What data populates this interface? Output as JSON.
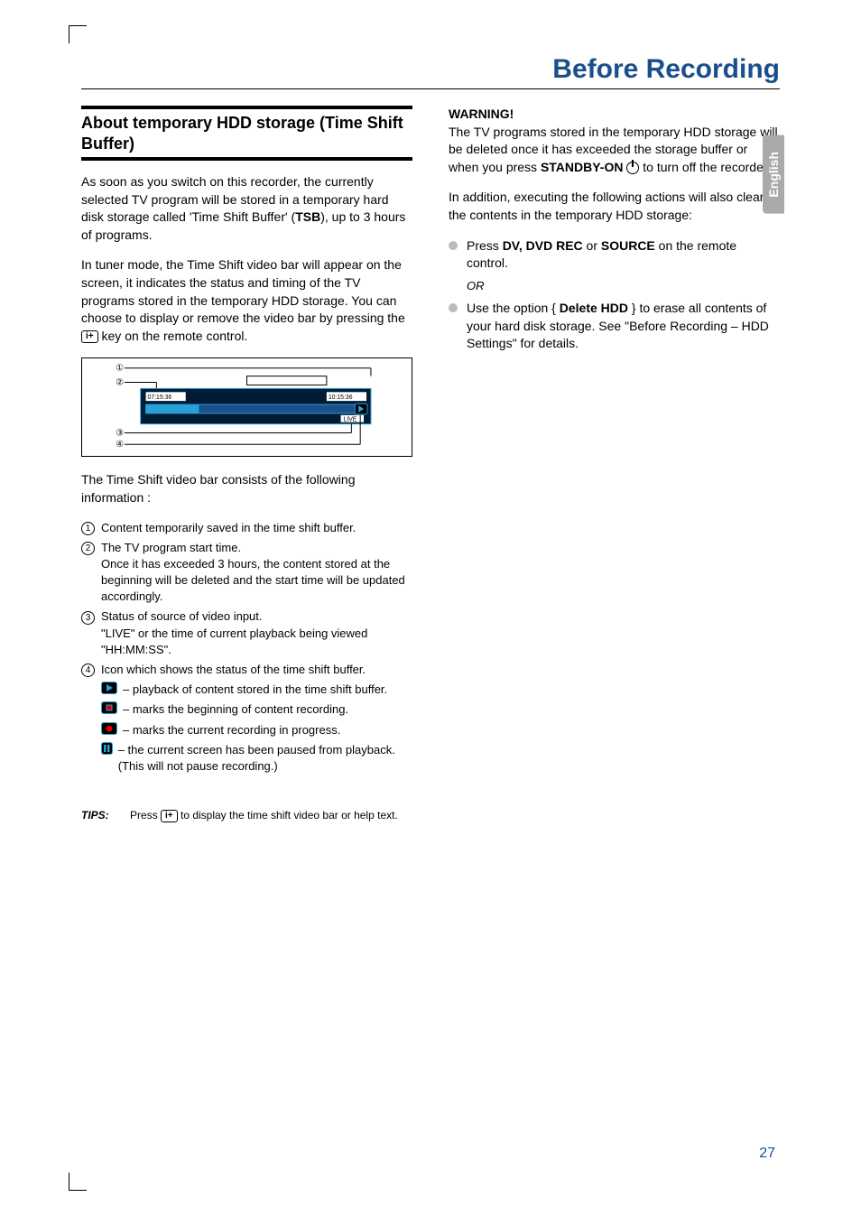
{
  "page": {
    "language_tab": "English",
    "page_number": "27",
    "header_title": "Before Recording"
  },
  "left": {
    "section_title": "About temporary HDD storage (Time Shift Buffer)",
    "para1_a": "As soon as you switch on this recorder, the currently selected TV program will be stored in a temporary hard disk storage called 'Time Shift Buffer' (",
    "para1_b": "TSB",
    "para1_c": "), up to 3 hours of programs.",
    "para2_a": "In tuner mode, the Time Shift video bar will appear on the screen, it indicates the status and timing of the TV programs stored in the temporary HDD storage. You can choose to display or remove the video bar by pressing the ",
    "para2_b": " key on the remote control.",
    "videobar": {
      "start_time": "07:15:36",
      "end_time": "10:15:36",
      "status": "LIVE"
    },
    "para3": "The Time Shift video bar consists of the following information :",
    "legend": {
      "n1": "Content temporarily saved in the time shift buffer.",
      "n2": "The TV program start time.\nOnce it has exceeded 3 hours, the content stored at the beginning will be deleted and the start time will be updated accordingly.",
      "n3": "Status of source of video input.\n\"LIVE\" or the time of current playback being viewed \"HH:MM:SS\".",
      "n4": "Icon which shows the status of the time shift buffer.",
      "ic1": "– playback of content stored in the time shift buffer.",
      "ic2": "– marks the beginning of content recording.",
      "ic3": "– marks the current recording in progress.",
      "ic4": "– the current screen has been paused from playback. (This will not pause recording.)"
    }
  },
  "right": {
    "warning_title": "WARNING!",
    "warn_a": "The TV programs stored in the temporary HDD storage will be deleted once it has exceeded the storage buffer or when you press ",
    "warn_b": "STANDBY-ON",
    "warn_c": " to turn off the recorder.",
    "warn2": "In addition, executing the following actions will also clear the contents in the temporary HDD storage:",
    "b1_a": "Press ",
    "b1_b": "DV, DVD REC",
    "b1_c": " or ",
    "b1_d": "SOURCE",
    "b1_e": " on the remote control.",
    "or": "OR",
    "b2_a": "Use the option { ",
    "b2_b": "Delete HDD",
    "b2_c": " } to erase all contents of your hard disk storage. See \"Before Recording – HDD Settings\" for details."
  },
  "tips": {
    "label": "TIPS:",
    "text_a": "Press ",
    "text_b": " to display the time shift video bar or help text."
  }
}
